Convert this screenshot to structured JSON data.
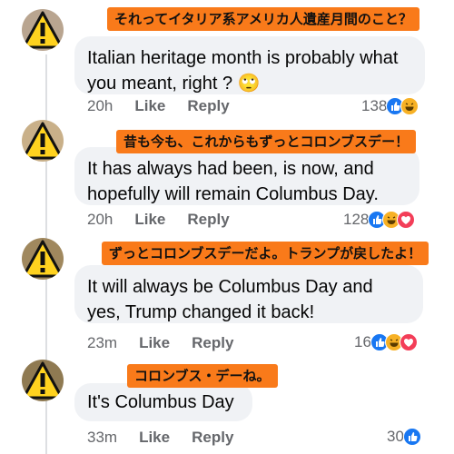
{
  "comments": [
    {
      "translation": "それってイタリア系アメリカ人遺産月間のこと？",
      "lines": [
        "Italian heritage month is probably what",
        "you meant, right ? 🙄"
      ],
      "time": "20h",
      "like_label": "Like",
      "reply_label": "Reply",
      "reaction_count": "138",
      "reactions": [
        "like",
        "haha"
      ]
    },
    {
      "translation": "昔も今も、これからもずっとコロンブスデー！",
      "lines": [
        "It has always had been, is now, and",
        "hopefully will remain Columbus Day."
      ],
      "time": "20h",
      "like_label": "Like",
      "reply_label": "Reply",
      "reaction_count": "128",
      "reactions": [
        "like",
        "haha",
        "love"
      ]
    },
    {
      "translation": "ずっとコロンブスデーだよ。トランプが戻したよ！",
      "lines": [
        "It will always be Columbus Day and",
        "yes, Trump changed it back!"
      ],
      "time": "23m",
      "like_label": "Like",
      "reply_label": "Reply",
      "reaction_count": "16",
      "reactions": [
        "like",
        "haha",
        "love"
      ]
    },
    {
      "translation": "コロンブス・デーね。",
      "lines": [
        "It's Columbus Day"
      ],
      "time": "33m",
      "like_label": "Like",
      "reply_label": "Reply",
      "reaction_count": "30",
      "reactions": [
        "like"
      ]
    }
  ],
  "colors": {
    "banner": "#f97a1a",
    "bubble": "#f0f2f5",
    "warning_yellow": "#ffd21f",
    "like_blue": "#1877f2"
  },
  "icons": {
    "avatar": "warning-triangle-icon",
    "like": "thumbs-up-icon",
    "haha": "laughing-face-icon",
    "love": "heart-icon"
  }
}
